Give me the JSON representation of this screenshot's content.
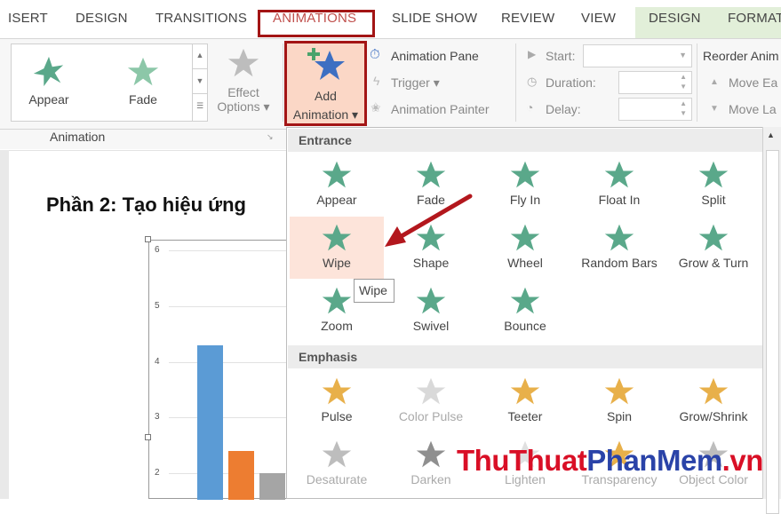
{
  "tabs": [
    {
      "label": "ISERT"
    },
    {
      "label": "DESIGN"
    },
    {
      "label": "TRANSITIONS"
    },
    {
      "label": "ANIMATIONS"
    },
    {
      "label": "SLIDE SHOW"
    },
    {
      "label": "REVIEW"
    },
    {
      "label": "VIEW"
    },
    {
      "label": "DESIGN"
    },
    {
      "label": "FORMAT"
    }
  ],
  "ribbon": {
    "gallery": [
      {
        "label": "Appear",
        "icon": "appear-star-icon"
      },
      {
        "label": "Fade",
        "icon": "fade-star-icon"
      }
    ],
    "effect_options": {
      "line1": "Effect",
      "line2": "Options ▾"
    },
    "add_animation": {
      "line1": "Add",
      "line2": "Animation ▾"
    },
    "animation_pane": "Animation Pane",
    "trigger": "Trigger ▾",
    "animation_painter": "Animation Painter",
    "start_label": "Start:",
    "duration_label": "Duration:",
    "delay_label": "Delay:",
    "reorder_label": "Reorder Anim",
    "move_earlier": "Move Ea",
    "move_later": "Move La",
    "group_label": "Animation"
  },
  "slide": {
    "title": "Phần 2: Tạo hiệu ứng"
  },
  "chart_data": {
    "type": "bar",
    "y_ticks": [
      "6",
      "5",
      "4",
      "3",
      "2"
    ],
    "ylim": [
      2,
      6
    ],
    "series": [
      {
        "color": "#5b9bd5",
        "values": [
          4.3
        ]
      },
      {
        "color": "#ed7d31",
        "values": [
          2.4
        ]
      },
      {
        "color": "#a5a5a5",
        "values": [
          2.0
        ]
      }
    ]
  },
  "panel": {
    "entrance_header": "Entrance",
    "emphasis_header": "Emphasis",
    "entrance": [
      {
        "label": "Appear",
        "icon": "appear-star-icon"
      },
      {
        "label": "Fade",
        "icon": "fade-star-icon"
      },
      {
        "label": "Fly In",
        "icon": "fly-in-star-icon"
      },
      {
        "label": "Float In",
        "icon": "float-in-star-icon"
      },
      {
        "label": "Split",
        "icon": "split-star-icon"
      },
      {
        "label": "Wipe",
        "icon": "wipe-star-icon"
      },
      {
        "label": "Shape",
        "icon": "shape-star-icon"
      },
      {
        "label": "Wheel",
        "icon": "wheel-star-icon"
      },
      {
        "label": "Random Bars",
        "icon": "random-bars-star-icon"
      },
      {
        "label": "Grow & Turn",
        "icon": "grow-turn-star-icon"
      },
      {
        "label": "Zoom",
        "icon": "zoom-star-icon"
      },
      {
        "label": "Swivel",
        "icon": "swivel-star-icon"
      },
      {
        "label": "Bounce",
        "icon": "bounce-star-icon"
      }
    ],
    "emphasis": [
      {
        "label": "Pulse",
        "icon": "pulse-star-icon"
      },
      {
        "label": "Color Pulse",
        "icon": "color-pulse-star-icon"
      },
      {
        "label": "Teeter",
        "icon": "teeter-star-icon"
      },
      {
        "label": "Spin",
        "icon": "spin-star-icon"
      },
      {
        "label": "Grow/Shrink",
        "icon": "grow-shrink-star-icon"
      },
      {
        "label": "Desaturate",
        "icon": "desaturate-star-icon"
      },
      {
        "label": "Darken",
        "icon": "darken-star-icon"
      },
      {
        "label": "Lighten",
        "icon": "lighten-star-icon"
      },
      {
        "label": "Transparency",
        "icon": "transparency-star-icon"
      },
      {
        "label": "Object Color",
        "icon": "object-color-star-icon"
      }
    ],
    "tooltip": "Wipe"
  },
  "watermark": {
    "part1": "ThuThuat",
    "part2": "PhanMem",
    "part3": ".vn"
  },
  "colors": {
    "accent_red": "#a31515",
    "entrance_green": "#5aa88a",
    "emphasis_gold": "#e8b04a",
    "format_tab_bg": "#e2efd9"
  }
}
